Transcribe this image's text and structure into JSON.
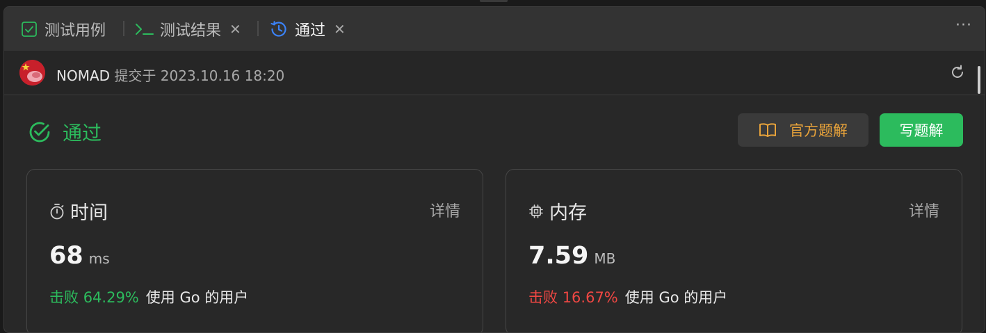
{
  "tabs": [
    {
      "label": "测试用例",
      "icon": "check-square-icon",
      "closable": false
    },
    {
      "label": "测试结果",
      "icon": "terminal-icon",
      "closable": true
    },
    {
      "label": "通过",
      "icon": "clock-history-icon",
      "closable": true,
      "active": true
    }
  ],
  "tab_close_glyph": "✕",
  "more_glyph": "···",
  "submission": {
    "user": "NOMAD",
    "submitted_label": "提交于",
    "timestamp": "2023.10.16 18:20"
  },
  "result": {
    "status": "通过",
    "official_solution_label": "官方题解",
    "write_solution_label": "写题解"
  },
  "runtime": {
    "title": "时间",
    "detail_label": "详情",
    "value": "68",
    "unit": "ms",
    "beats_label": "击败",
    "beats_percent": "64.29%",
    "users_text": "使用 Go 的用户"
  },
  "memory": {
    "title": "内存",
    "detail_label": "详情",
    "value": "7.59",
    "unit": "MB",
    "beats_label": "击败",
    "beats_percent": "16.67%",
    "users_text": "使用 Go 的用户"
  },
  "colors": {
    "accept_green": "#2cbb5d",
    "beats_red": "#ef4743",
    "solution_orange": "#e8a33a",
    "tab_blue": "#3b82f6"
  }
}
